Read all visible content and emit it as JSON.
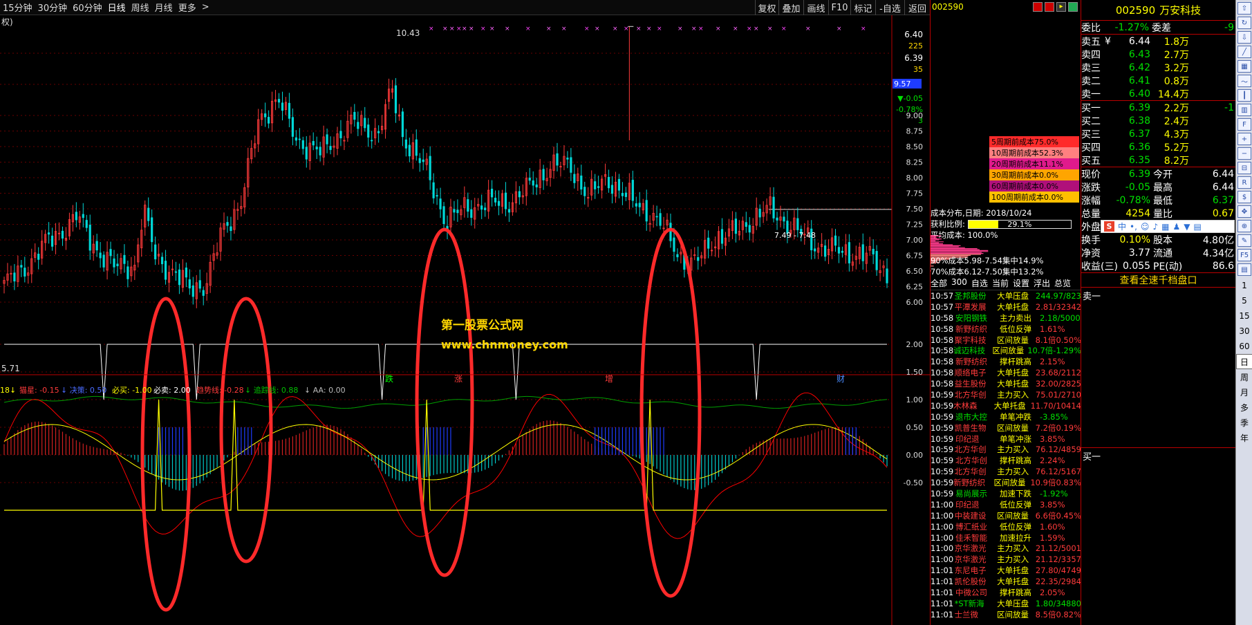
{
  "timeframes": [
    "15分钟",
    "30分钟",
    "60分钟",
    "日线",
    "周线",
    "月线",
    "更多"
  ],
  "timeframe_more_arrow": ">",
  "toolbar_buttons": [
    "复权",
    "叠加",
    "画线",
    "F10",
    "标记",
    "-自选",
    "返回"
  ],
  "chart": {
    "indicator_name_left": "权)",
    "high_label": "10.43",
    "low_label": "5.71",
    "price_labels": [
      "6.40",
      "225",
      "6.39",
      "35"
    ],
    "current_price_box": "9.57",
    "change": "▼-0.05",
    "change_pct": "-0.78%",
    "change_count": "3",
    "price_axis": [
      "9.00",
      "8.75",
      "8.50",
      "8.25",
      "8.00",
      "7.75",
      "7.50",
      "7.25",
      "7.00",
      "6.75",
      "6.50",
      "6.25",
      "6.00"
    ],
    "range_label": "7.49 - 7.48",
    "watermark_title": "第一股票公式网",
    "watermark_url": "www.chnmoney.com",
    "event_markers": [
      "跌",
      "涨",
      "增",
      "财"
    ],
    "indicator_bar": [
      {
        "text": "18↓",
        "color": "#ffff00"
      },
      {
        "text": "猫星: -0.15",
        "color": "#ff3b3b"
      },
      {
        "text": "↓ 决策: 0.50",
        "color": "#4a6bff"
      },
      {
        "text": "必买: -1.00",
        "color": "#ffff00"
      },
      {
        "text": "必卖: 2.00",
        "color": "#ffffff"
      },
      {
        "text": "趋势线: -0.28",
        "color": "#ff3b3b"
      },
      {
        "text": "↓ 追踪线: 0.88",
        "color": "#00c000"
      },
      {
        "text": "↓ AA: 0.00",
        "color": "#bbbbbb"
      }
    ],
    "indicator_axis": [
      "2.00",
      "1.50",
      "1.00",
      "0.50",
      "0.00",
      "-0.50"
    ]
  },
  "cost_panel": {
    "code": "002590",
    "rows": [
      {
        "label": "5周期前成本75.0%",
        "bg": "#ff2a2a"
      },
      {
        "label": "10周期前成本52.3%",
        "bg": "#ff8080"
      },
      {
        "label": "20周期前成本11.1%",
        "bg": "#e01a8c"
      },
      {
        "label": "30周期前成本0.0%",
        "bg": "#ffa500"
      },
      {
        "label": "60周期前成本0.0%",
        "bg": "#b0107a"
      },
      {
        "label": "100周期前成本0.0%",
        "bg": "#ffc000"
      }
    ],
    "date_label": "成本分布,日期:",
    "date": "2018/10/24",
    "profit_label": "获利比例:",
    "profit_pct": "29.1%",
    "avg_cost_label": "平均成本:",
    "avg_cost": "100.0%",
    "concentration_90": "90%成本5.98-7.54集中14.9%",
    "concentration_70": "70%成本6.12-7.50集中13.2%",
    "tabs": [
      "全部",
      "300",
      "自选",
      "当前",
      "设置",
      "浮出",
      "总览"
    ]
  },
  "trades": [
    [
      "10:57",
      "圣邦股份",
      "大单压盘",
      "244.97/823",
      "grn"
    ],
    [
      "10:57",
      "平潭发展",
      "大单托盘",
      "2.81/32342",
      "red"
    ],
    [
      "10:58",
      "安阳钢铁",
      "主力卖出",
      "2.18/5000",
      "grn"
    ],
    [
      "10:58",
      "新野纺织",
      "低位反弹",
      "1.61%",
      "red"
    ],
    [
      "10:58",
      "聚宇科技",
      "区间放量",
      "8.1倍0.50%",
      "red"
    ],
    [
      "10:58",
      "诚迈科技",
      "区间放量",
      "10.7倍-1.29%",
      "grn"
    ],
    [
      "10:58",
      "新野纺织",
      "撑杆跳高",
      "2.15%",
      "red"
    ],
    [
      "10:58",
      "顺络电子",
      "大单托盘",
      "23.68/2112",
      "red"
    ],
    [
      "10:58",
      "益生股份",
      "大单托盘",
      "32.00/2825",
      "red"
    ],
    [
      "10:59",
      "北方华创",
      "主力买入",
      "75.01/2710",
      "red"
    ],
    [
      "10:59",
      "木林森",
      "大单托盘",
      "11.70/10414",
      "red"
    ],
    [
      "10:59",
      "退市大控",
      "单笔冲跌",
      "-3.85%",
      "grn"
    ],
    [
      "10:59",
      "凯普生物",
      "区间放量",
      "7.2倍0.19%",
      "red"
    ],
    [
      "10:59",
      "印纪退",
      "单笔冲涨",
      "3.85%",
      "red"
    ],
    [
      "10:59",
      "北方华创",
      "主力买入",
      "76.12/4859",
      "red"
    ],
    [
      "10:59",
      "北方华创",
      "撑杆跳高",
      "2.24%",
      "red"
    ],
    [
      "10:59",
      "北方华创",
      "主力买入",
      "76.12/5167",
      "red"
    ],
    [
      "10:59",
      "新野纺织",
      "区间放量",
      "10.9倍0.83%",
      "red"
    ],
    [
      "10:59",
      "易尚展示",
      "加速下跌",
      "-1.92%",
      "grn"
    ],
    [
      "11:00",
      "印纪退",
      "低位反弹",
      "3.85%",
      "red"
    ],
    [
      "11:00",
      "中装建设",
      "区间放量",
      "6.6倍0.45%",
      "red"
    ],
    [
      "11:00",
      "博汇纸业",
      "低位反弹",
      "1.60%",
      "red"
    ],
    [
      "11:00",
      "佳禾智能",
      "加速拉升",
      "1.59%",
      "red"
    ],
    [
      "11:00",
      "京华激光",
      "主力买入",
      "21.12/5001",
      "red"
    ],
    [
      "11:00",
      "京华激光",
      "主力买入",
      "21.12/3357",
      "red"
    ],
    [
      "11:01",
      "东尼电子",
      "大单托盘",
      "27.80/4749",
      "red"
    ],
    [
      "11:01",
      "凯伦股份",
      "大单托盘",
      "22.35/2984",
      "red"
    ],
    [
      "11:01",
      "中微公司",
      "撑杆跳高",
      "2.05%",
      "red"
    ],
    [
      "11:01",
      "*ST新海",
      "大单压盘",
      "1.80/34880",
      "grn"
    ],
    [
      "11:01",
      "士兰微",
      "区间放量",
      "8.5倍0.82%",
      "red"
    ]
  ],
  "quote": {
    "code": "002590",
    "name": "万安科技",
    "wei_bi_label": "委比",
    "wei_bi": "-1.27%",
    "wei_cha_label": "委差",
    "wei_cha": "-9",
    "asks": [
      {
        "label": "卖五",
        "mark": "¥",
        "price": "6.44",
        "vol": "1.8万"
      },
      {
        "label": "卖四",
        "mark": "",
        "price": "6.43",
        "vol": "2.7万"
      },
      {
        "label": "卖三",
        "mark": "",
        "price": "6.42",
        "vol": "3.2万"
      },
      {
        "label": "卖二",
        "mark": "",
        "price": "6.41",
        "vol": "0.8万"
      },
      {
        "label": "卖一",
        "mark": "",
        "price": "6.40",
        "vol": "14.4万"
      }
    ],
    "bids": [
      {
        "label": "买一",
        "price": "6.39",
        "vol": "2.2万",
        "extra": "-1"
      },
      {
        "label": "买二",
        "price": "6.38",
        "vol": "2.4万",
        "extra": ""
      },
      {
        "label": "买三",
        "price": "6.37",
        "vol": "4.3万",
        "extra": ""
      },
      {
        "label": "买四",
        "price": "6.36",
        "vol": "5.2万",
        "extra": ""
      },
      {
        "label": "买五",
        "price": "6.35",
        "vol": "8.2万",
        "extra": ""
      }
    ],
    "stats": [
      {
        "l1": "现价",
        "v1": "6.39",
        "c1": "grn",
        "l2": "今开",
        "v2": "6.44",
        "c2": "wht"
      },
      {
        "l1": "涨跌",
        "v1": "-0.05",
        "c1": "grn",
        "l2": "最高",
        "v2": "6.44",
        "c2": "wht"
      },
      {
        "l1": "涨幅",
        "v1": "-0.78%",
        "c1": "grn",
        "l2": "最低",
        "v2": "6.37",
        "c2": "grn"
      },
      {
        "l1": "总量",
        "v1": "4254",
        "c1": "yel",
        "l2": "量比",
        "v2": "0.67",
        "c2": "yel"
      }
    ],
    "wai_pan_label": "外盘",
    "stats2": [
      {
        "l1": "换手",
        "v1": "0.10%",
        "l2": "股本",
        "v2": "4.80亿"
      },
      {
        "l1": "净资",
        "v1": "3.77",
        "l2": "流通",
        "v2": "4.34亿"
      },
      {
        "l1": "收益(三)",
        "v1": "0.055",
        "l2": "PE(动)",
        "v2": "86.6"
      }
    ],
    "full_depth_link": "查看全速千档盘口",
    "sell1_label": "卖一",
    "buy1_label": "买一"
  },
  "side_toolbar_text": [
    "1",
    "5",
    "15",
    "30",
    "60",
    "日",
    "周",
    "月",
    "多",
    "季",
    "年"
  ],
  "colors": {
    "up": "#ff3b3b",
    "down": "#00d8d8",
    "ma_red": "#ff0000",
    "ma_yellow": "#ffff00",
    "ma_green": "#00b000",
    "grid": "#7a0000",
    "accent_blue": "#1e3cff"
  }
}
